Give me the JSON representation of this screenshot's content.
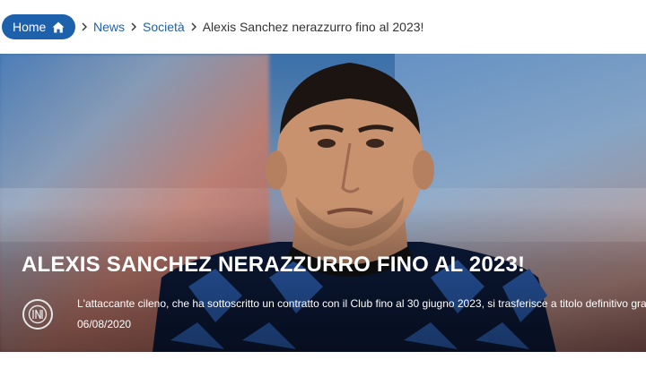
{
  "breadcrumb": {
    "home_label": "Home",
    "items": [
      {
        "label": "News"
      },
      {
        "label": "Società"
      }
    ],
    "current": "Alexis Sanchez nerazzurro fino al 2023!"
  },
  "hero": {
    "headline": "ALEXIS SANCHEZ NERAZZURRO FINO AL 2023!",
    "summary": "L'attaccante cileno, che ha sottoscritto un contratto con il Club fino al 30 giugno 2023, si trasferisce a titolo definitivo gratuito",
    "date": "06/08/2020",
    "logo_icon": "inter-logo-icon"
  },
  "colors": {
    "accent": "#1d61ad",
    "text": "#333333"
  }
}
